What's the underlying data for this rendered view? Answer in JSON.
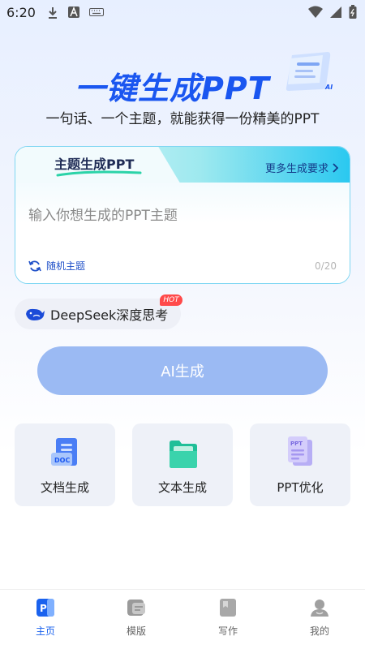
{
  "status_bar": {
    "time": "6:20"
  },
  "hero": {
    "title": "一键生成PPT",
    "subtitle": "一句话、一个主题，就能获得一份精美的PPT",
    "badge": "AI"
  },
  "card": {
    "tab_label": "主题生成PPT",
    "more_requirements": "更多生成要求",
    "input_placeholder": "输入你想生成的PPT主题",
    "input_value": "",
    "random_topic": "随机主题",
    "char_count": "0/20"
  },
  "deepseek": {
    "label": "DeepSeek深度思考",
    "hot_badge": "HOT"
  },
  "generate_button": "AI生成",
  "features": [
    {
      "label": "文档生成",
      "icon": "doc-icon",
      "icon_text": "DOC"
    },
    {
      "label": "文本生成",
      "icon": "folder-icon"
    },
    {
      "label": "PPT优化",
      "icon": "ppt-file-icon",
      "icon_text": "PPT"
    }
  ],
  "bottom_nav": [
    {
      "label": "主页",
      "icon": "home-ppt-icon",
      "active": true
    },
    {
      "label": "模版",
      "icon": "template-icon",
      "active": false
    },
    {
      "label": "写作",
      "icon": "writing-icon",
      "active": false
    },
    {
      "label": "我的",
      "icon": "profile-icon",
      "active": false
    }
  ],
  "colors": {
    "accent": "#1a56f0",
    "button": "#9bbaf3",
    "hot": "#ff4a4a",
    "nav_active": "#1a62ee"
  }
}
